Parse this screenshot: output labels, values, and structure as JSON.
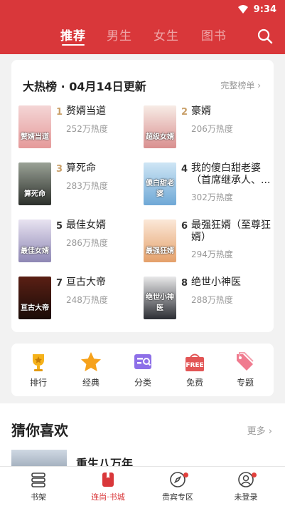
{
  "status_bar": {
    "time": "9:34"
  },
  "top_tabs": [
    {
      "label": "推荐",
      "active": true
    },
    {
      "label": "男生",
      "active": false
    },
    {
      "label": "女生",
      "active": false
    },
    {
      "label": "图书",
      "active": false
    }
  ],
  "ranking": {
    "title": "大热榜 · 04月14日更新",
    "more_label": "完整榜单 ›",
    "books": [
      {
        "rank": "1",
        "name": "赘婿当道",
        "heat": "252万热度",
        "cover_text": "赘婿当道"
      },
      {
        "rank": "2",
        "name": "豪婿",
        "heat": "206万热度",
        "cover_text": "超级女婿"
      },
      {
        "rank": "3",
        "name": "算死命",
        "heat": "283万热度",
        "cover_text": "算死命"
      },
      {
        "rank": "4",
        "name": "我的傻白甜老婆（首席继承人、...",
        "heat": "302万热度",
        "cover_text": "傻白甜老婆"
      },
      {
        "rank": "5",
        "name": "最佳女婿",
        "heat": "286万热度",
        "cover_text": "最佳女婿"
      },
      {
        "rank": "6",
        "name": "最强狂婿（至尊狂婿）",
        "heat": "294万热度",
        "cover_text": "最强狂婿"
      },
      {
        "rank": "7",
        "name": "亘古大帝",
        "heat": "248万热度",
        "cover_text": "亘古大帝"
      },
      {
        "rank": "8",
        "name": "绝世小神医",
        "heat": "288万热度",
        "cover_text": "绝世小神医"
      }
    ]
  },
  "quick_menu": [
    {
      "label": "排行",
      "icon": "trophy-icon"
    },
    {
      "label": "经典",
      "icon": "star-icon"
    },
    {
      "label": "分类",
      "icon": "category-icon"
    },
    {
      "label": "免费",
      "icon": "free-icon"
    },
    {
      "label": "专题",
      "icon": "tag-icon"
    }
  ],
  "guess": {
    "title": "猜你喜欢",
    "more_label": "更多 ›",
    "first_book": "重生八万年"
  },
  "bottom_nav": [
    {
      "label": "书架",
      "icon": "bookshelf-icon",
      "active": false,
      "dot": false
    },
    {
      "label": "连尚·书城",
      "icon": "bookstore-icon",
      "active": true,
      "dot": false
    },
    {
      "label": "贵宾专区",
      "icon": "compass-icon",
      "active": false,
      "dot": true
    },
    {
      "label": "未登录",
      "icon": "user-icon",
      "active": false,
      "dot": true
    }
  ],
  "colors": {
    "brand": "#d9373a",
    "rank_top": "#c9a06a",
    "rank_other": "#333333"
  }
}
